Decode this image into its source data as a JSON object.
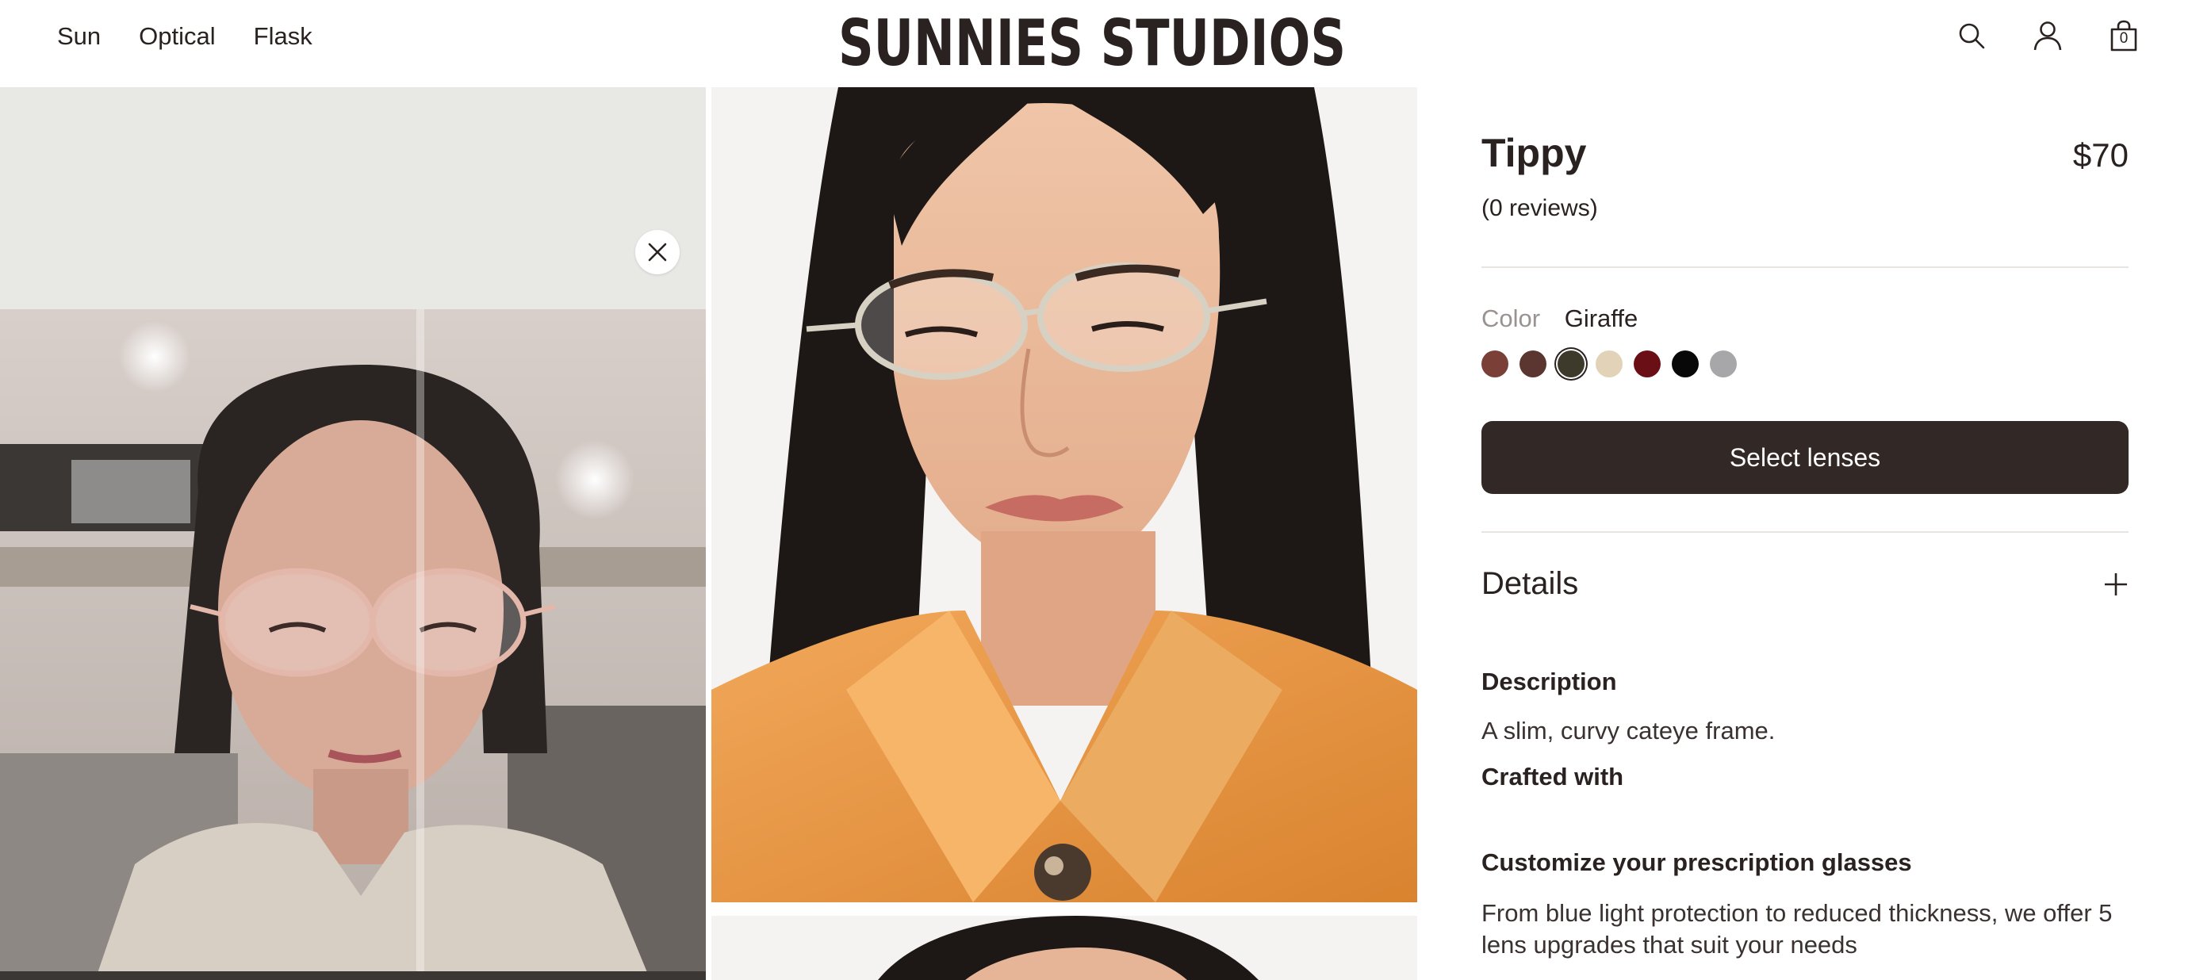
{
  "nav": {
    "items": [
      "Sun",
      "Optical",
      "Flask"
    ]
  },
  "brand": {
    "logo_text": "SUNNIES STUDIOS"
  },
  "header_icons": {
    "search": "search-icon",
    "account": "user-icon",
    "cart": "bag-icon",
    "cart_count": "0"
  },
  "gallery": {
    "close": "close-icon"
  },
  "product": {
    "title": "Tippy",
    "price": "$70",
    "reviews": "(0 reviews)",
    "color_label": "Color",
    "color_value": "Giraffe",
    "swatches": [
      {
        "color": "#7a3f37",
        "selected": false
      },
      {
        "color": "#5b3530",
        "selected": false
      },
      {
        "color": "#3d3a2c",
        "selected": true
      },
      {
        "color": "#e2d3b8",
        "selected": false
      },
      {
        "color": "#6b0f17",
        "selected": false
      },
      {
        "color": "#080808",
        "selected": false
      },
      {
        "color": "#a7a7a9",
        "selected": false
      }
    ],
    "select_lenses": "Select lenses",
    "details_title": "Details",
    "description_heading": "Description",
    "description_text": "A slim, curvy cateye frame.",
    "crafted_heading": "Crafted with",
    "customize_heading": "Customize your prescription glasses",
    "customize_text": "From blue light protection to reduced thickness, we offer 5 lens upgrades that suit your needs"
  },
  "colors": {
    "text": "#2a2220",
    "button": "#322826",
    "muted": "#9a9290"
  }
}
